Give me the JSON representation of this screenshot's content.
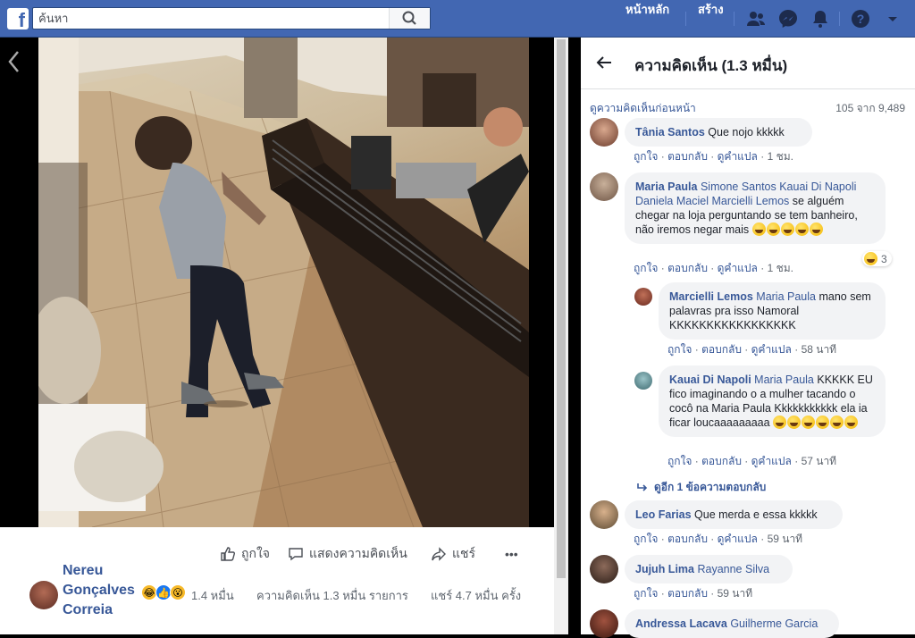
{
  "topbar": {
    "search_placeholder": "ค้นหา",
    "nav_home": "หน้าหลัก",
    "nav_create": "สร้าง"
  },
  "bottom_bar": {
    "like_label": "ถูกใจ",
    "comment_label": "แสดงความคิดเห็น",
    "share_label": "แชร์",
    "more_label": "•••",
    "poster_name": "Nereu Gonçalves Correia",
    "reactions_count": "1.4 หมื่น",
    "comments_count": "ความคิดเห็น 1.3 หมื่น รายการ",
    "shares_count": "แชร์ 4.7 หมื่น ครั้ง"
  },
  "panel": {
    "title": "ความคิดเห็น (1.3 หมื่น)",
    "prev_link": "ดูความคิดเห็นก่อนหน้า",
    "count": "105 จาก 9,489",
    "replies_link": "ดูอีก 1 ข้อความตอบกลับ"
  },
  "action_labels": {
    "like": "ถูกใจ",
    "reply": "ตอบกลับ",
    "translate": "ดูคำแปล"
  },
  "comments": [
    {
      "author": "Tânia Santos",
      "tag": "",
      "text": "Que nojo kkkkk",
      "time": "1 ชม."
    },
    {
      "author": "Maria Paula",
      "tag": "Simone Santos Kauai Di Napoli Daniela Maciel Marcielli Lemos",
      "text": "se alguém chegar na loja perguntando se tem banheiro, não iremos negar mais",
      "time": "1 ชม.",
      "reactions": "3"
    },
    {
      "author": "Marcielli Lemos",
      "tag": "Maria Paula",
      "text": "mano sem palavras pra isso Namoral KKKKKKKKKKKKKKKKK",
      "time": "58 นาที"
    },
    {
      "author": "Kauai Di Napoli",
      "tag": "Maria Paula",
      "text": "KKKKK EU fico imaginando o a mulher tacando o cocô na Maria Paula Kkkkkkkkkkk ela ia ficar loucaaaaaaaaa",
      "time": "57 นาที"
    },
    {
      "author": "Leo Farias",
      "tag": "",
      "text": "Que merda e essa kkkkk",
      "time": "59 นาที"
    },
    {
      "author": "Jujuh Lima",
      "tag": "Rayanne Silva",
      "text": "",
      "time": "59 นาที"
    },
    {
      "author": "Andressa Lacava",
      "tag": "Guilherme Garcia",
      "text": "",
      "time": ""
    }
  ],
  "colors": {
    "brand": "#4267b2",
    "link": "#385898",
    "bubble": "#f2f3f5"
  }
}
